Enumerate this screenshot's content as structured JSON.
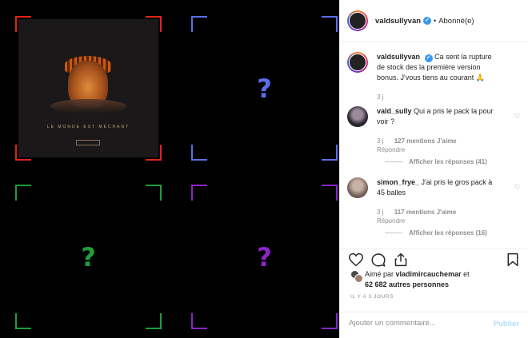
{
  "post": {
    "grid": [
      {
        "type": "album",
        "color": "#e2231a",
        "icon": "album-cover"
      },
      {
        "type": "mystery",
        "color": "#5c6de8",
        "symbol": "?"
      },
      {
        "type": "mystery",
        "color": "#1f9d3a",
        "symbol": "?"
      },
      {
        "type": "mystery",
        "color": "#8a26c8",
        "symbol": "?"
      }
    ],
    "album_title": "LE MONDE EST MÉCHANT"
  },
  "header": {
    "username": "valdsullyvan",
    "follow_separator": "•",
    "follow_label": "Abonné(e)"
  },
  "caption": {
    "username": "valdsullyvan",
    "text": "Ca sent la rupture de stock des la première version bonus. J'vous tiens au courant 🙏",
    "age": "3 j"
  },
  "comments": [
    {
      "username": "vald_sully",
      "text": "Qui a pris le pack la pour voir ?",
      "age": "3 j",
      "likes": "127 mentions J'aime",
      "reply": "Répondre",
      "replies": "Afficher les réponses (41)"
    },
    {
      "username": "simon_frye_",
      "text": "J'ai pris le gros pack à 45 balles",
      "age": "3 j",
      "likes": "117 mentions J'aime",
      "reply": "Répondre",
      "replies": "Afficher les réponses (16)"
    }
  ],
  "likes": {
    "prefix": "Aimé par",
    "liker": "vladimircauchemar",
    "conjunction": "et",
    "others": "62 682 autres personnes"
  },
  "timestamp": "IL Y A 3 JOURS",
  "add_comment": {
    "placeholder": "Ajouter un commentaire...",
    "post_label": "Publier"
  },
  "colors": {
    "link_disabled": "#b2dffc",
    "verified": "#3897f0",
    "muted": "#8e8e8e"
  }
}
